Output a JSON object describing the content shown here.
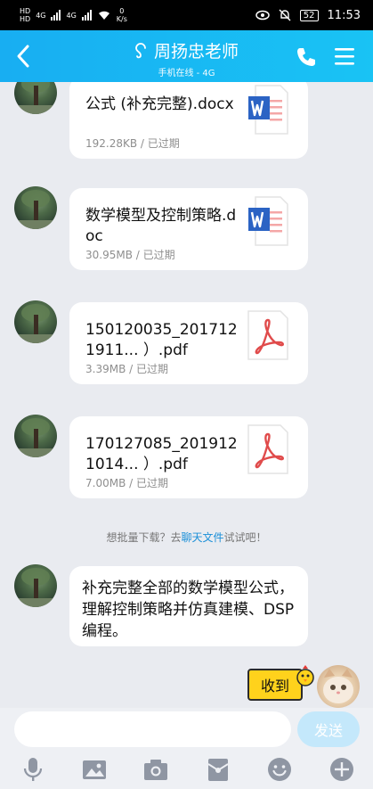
{
  "status": {
    "left_hd1": "HD",
    "left_4g1": "4G",
    "left_hd2": "HD",
    "left_4g2": "4G",
    "speed_value": "0",
    "speed_unit": "K/s",
    "battery": "52",
    "time": "11:53"
  },
  "header": {
    "title": "周扬忠老师",
    "subtitle": "手机在线 - 4G",
    "accent": "#18aef2"
  },
  "messages": [
    {
      "name": "公式 (补充完整).docx",
      "meta": "192.28KB / 已过期",
      "type": "word"
    },
    {
      "name": "数学模型及控制策略.doc",
      "meta": "30.95MB / 已过期",
      "type": "word"
    },
    {
      "name": "150120035_2017121911... ）.pdf",
      "meta": "3.39MB / 已过期",
      "type": "pdf"
    },
    {
      "name": "170127085_2019121014... ）.pdf",
      "meta": "7.00MB / 已过期",
      "type": "pdf"
    }
  ],
  "hint": {
    "prefix": "想批量下载？去",
    "link": "聊天文件",
    "suffix": "试试吧！"
  },
  "text_message": "补充完整全部的数学模型公式，理解控制策略并仿真建模、DSP编程。",
  "sticker_text": "收到",
  "input": {
    "placeholder": "",
    "send_label": "发送"
  },
  "toolbar_icons": [
    "microphone-icon",
    "image-icon",
    "camera-icon",
    "red-packet-icon",
    "emoji-icon",
    "plus-icon"
  ]
}
